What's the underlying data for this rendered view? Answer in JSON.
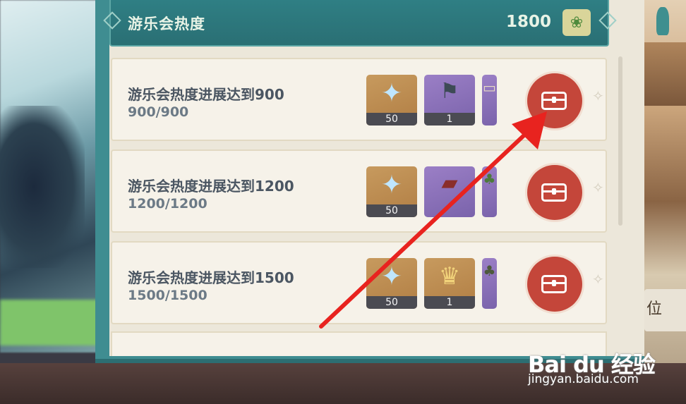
{
  "header": {
    "title": "游乐会热度",
    "value": "1800",
    "emblem_icon": "lotus-emblem-icon"
  },
  "rows": [
    {
      "title": "游乐会热度进展达到900",
      "progress": "900/900",
      "items": [
        {
          "icon": "primogem-icon",
          "count": "50",
          "bg": "gold"
        },
        {
          "icon": "banner-furnishing-icon",
          "count": "1",
          "bg": "purple"
        },
        {
          "icon": "furnishing-icon",
          "count": "",
          "bg": "purple"
        }
      ]
    },
    {
      "title": "游乐会热度进展达到1200",
      "progress": "1200/1200",
      "items": [
        {
          "icon": "primogem-icon",
          "count": "50",
          "bg": "gold"
        },
        {
          "icon": "stall-furnishing-icon",
          "count": "",
          "bg": "purple"
        },
        {
          "icon": "plant-furnishing-icon",
          "count": "",
          "bg": "purple"
        }
      ]
    },
    {
      "title": "游乐会热度进展达到1500",
      "progress": "1500/1500",
      "items": [
        {
          "icon": "primogem-icon",
          "count": "50",
          "bg": "gold"
        },
        {
          "icon": "crown-icon",
          "count": "1",
          "bg": "gold"
        },
        {
          "icon": "furnishing-icon",
          "count": "",
          "bg": "purple"
        }
      ]
    }
  ],
  "side_text": "位",
  "watermark": {
    "logo": "Bai du 经验",
    "url": "jingyan.baidu.com"
  },
  "colors": {
    "accent_teal": "#2f7f84",
    "claim_red": "#c4463a",
    "arrow_red": "#e8231f"
  }
}
